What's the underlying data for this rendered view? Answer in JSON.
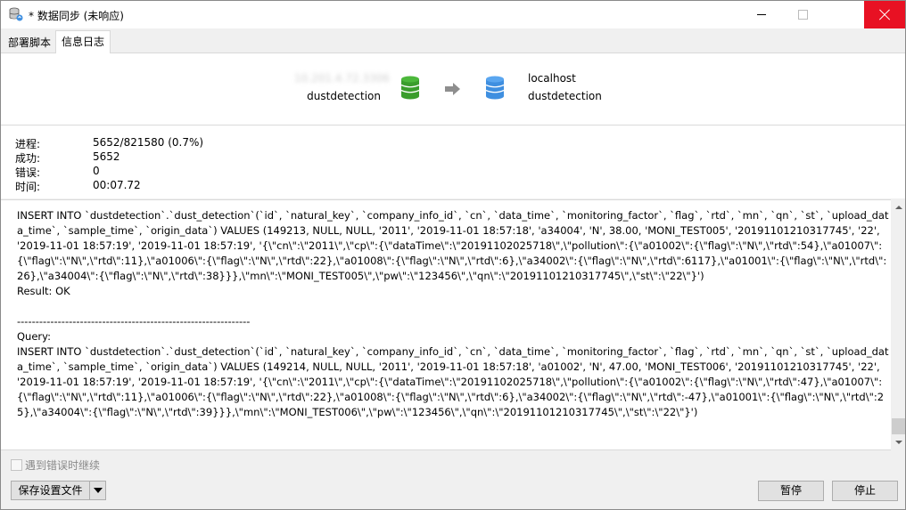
{
  "window": {
    "title": "* 数据同步 (未响应)"
  },
  "tabs": [
    {
      "label": "部署脚本",
      "active": false
    },
    {
      "label": "信息日志",
      "active": true
    }
  ],
  "source": {
    "host": "10.201.4.72.3306",
    "database": "dustdetection",
    "icon": "database-icon",
    "color": "#3a9d2c"
  },
  "target": {
    "host": "localhost",
    "database": "dustdetection",
    "icon": "database-icon",
    "color": "#3f8fe0"
  },
  "stats": [
    {
      "label": "进程:",
      "value": "5652/821580 (0.7%)"
    },
    {
      "label": "成功:",
      "value": "5652"
    },
    {
      "label": "错误:",
      "value": "0"
    },
    {
      "label": "时间:",
      "value": "00:07.72"
    }
  ],
  "log": {
    "text": "INSERT INTO `dustdetection`.`dust_detection`(`id`, `natural_key`, `company_info_id`, `cn`, `data_time`, `monitoring_factor`, `flag`, `rtd`, `mn`, `qn`, `st`, `upload_data_time`, `sample_time`, `origin_data`) VALUES (149213, NULL, NULL, '2011', '2019-11-01 18:57:18', 'a34004', 'N', 38.00, 'MONI_TEST005', '20191101210317745', '22', '2019-11-01 18:57:19', '2019-11-01 18:57:19', '{\\\"cn\\\":\\\"2011\\\",\\\"cp\\\":{\\\"dataTime\\\":\\\"20191102025718\\\",\\\"pollution\\\":{\\\"a01002\\\":{\\\"flag\\\":\\\"N\\\",\\\"rtd\\\":54},\\\"a01007\\\":{\\\"flag\\\":\\\"N\\\",\\\"rtd\\\":11},\\\"a01006\\\":{\\\"flag\\\":\\\"N\\\",\\\"rtd\\\":22},\\\"a01008\\\":{\\\"flag\\\":\\\"N\\\",\\\"rtd\\\":6},\\\"a34002\\\":{\\\"flag\\\":\\\"N\\\",\\\"rtd\\\":6117},\\\"a01001\\\":{\\\"flag\\\":\\\"N\\\",\\\"rtd\\\":26},\\\"a34004\\\":{\\\"flag\\\":\\\"N\\\",\\\"rtd\\\":38}}},\\\"mn\\\":\\\"MONI_TEST005\\\",\\\"pw\\\":\\\"123456\\\",\\\"qn\\\":\\\"20191101210317745\\\",\\\"st\\\":\\\"22\\\"}')\nResult: OK\n\n---------------------------------------------------------------\nQuery:\nINSERT INTO `dustdetection`.`dust_detection`(`id`, `natural_key`, `company_info_id`, `cn`, `data_time`, `monitoring_factor`, `flag`, `rtd`, `mn`, `qn`, `st`, `upload_data_time`, `sample_time`, `origin_data`) VALUES (149214, NULL, NULL, '2011', '2019-11-01 18:57:18', 'a01002', 'N', 47.00, 'MONI_TEST006', '20191101210317745', '22', '2019-11-01 18:57:19', '2019-11-01 18:57:19', '{\\\"cn\\\":\\\"2011\\\",\\\"cp\\\":{\\\"dataTime\\\":\\\"20191102025718\\\",\\\"pollution\\\":{\\\"a01002\\\":{\\\"flag\\\":\\\"N\\\",\\\"rtd\\\":47},\\\"a01007\\\":{\\\"flag\\\":\\\"N\\\",\\\"rtd\\\":11},\\\"a01006\\\":{\\\"flag\\\":\\\"N\\\",\\\"rtd\\\":22},\\\"a01008\\\":{\\\"flag\\\":\\\"N\\\",\\\"rtd\\\":6},\\\"a34002\\\":{\\\"flag\\\":\\\"N\\\",\\\"rtd\\\":-47},\\\"a01001\\\":{\\\"flag\\\":\\\"N\\\",\\\"rtd\\\":25},\\\"a34004\\\":{\\\"flag\\\":\\\"N\\\",\\\"rtd\\\":39}}},\\\"mn\\\":\\\"MONI_TEST006\\\",\\\"pw\\\":\\\"123456\\\",\\\"qn\\\":\\\"20191101210317745\\\",\\\"st\\\":\\\"22\\\"}')"
  },
  "footer": {
    "continue_on_error_label": "遇到错误时继续",
    "continue_on_error_checked": false,
    "save_settings_label": "保存设置文件",
    "pause_label": "暂停",
    "stop_label": "停止"
  }
}
